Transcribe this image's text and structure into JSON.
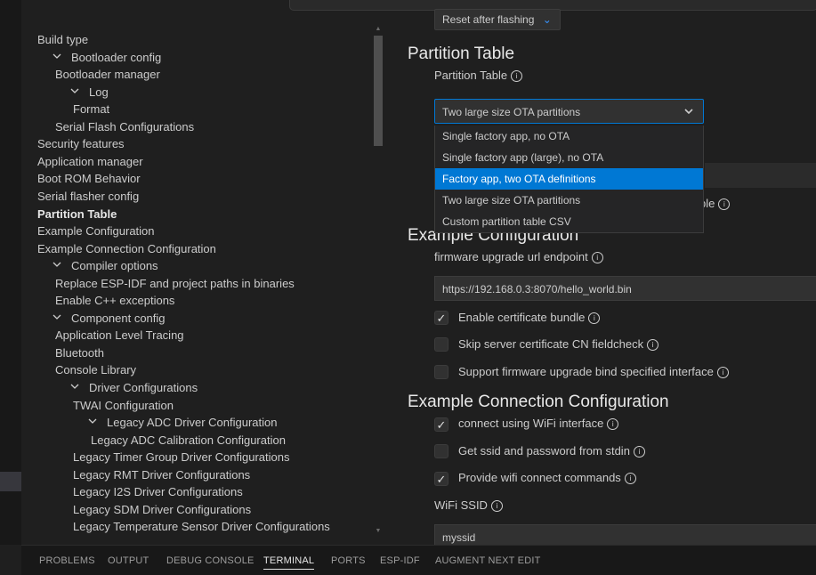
{
  "tree": {
    "items": [
      {
        "label": "Build type",
        "indent": 0,
        "chevron": false,
        "bold": false
      },
      {
        "label": "Bootloader config",
        "indent": 1,
        "chevron": true,
        "bold": false
      },
      {
        "label": "Bootloader manager",
        "indent": 1,
        "chevron": false,
        "bold": false
      },
      {
        "label": "Log",
        "indent": 2,
        "chevron": true,
        "bold": false
      },
      {
        "label": "Format",
        "indent": 2,
        "chevron": false,
        "bold": false
      },
      {
        "label": "Serial Flash Configurations",
        "indent": 1,
        "chevron": false,
        "bold": false
      },
      {
        "label": "Security features",
        "indent": 0,
        "chevron": false,
        "bold": false
      },
      {
        "label": "Application manager",
        "indent": 0,
        "chevron": false,
        "bold": false
      },
      {
        "label": "Boot ROM Behavior",
        "indent": 0,
        "chevron": false,
        "bold": false
      },
      {
        "label": "Serial flasher config",
        "indent": 0,
        "chevron": false,
        "bold": false
      },
      {
        "label": "Partition Table",
        "indent": 0,
        "chevron": false,
        "bold": true
      },
      {
        "label": "Example Configuration",
        "indent": 0,
        "chevron": false,
        "bold": false
      },
      {
        "label": "Example Connection Configuration",
        "indent": 0,
        "chevron": false,
        "bold": false
      },
      {
        "label": "Compiler options",
        "indent": 1,
        "chevron": true,
        "bold": false
      },
      {
        "label": "Replace ESP-IDF and project paths in binaries",
        "indent": 1,
        "chevron": false,
        "bold": false
      },
      {
        "label": "Enable C++ exceptions",
        "indent": 1,
        "chevron": false,
        "bold": false
      },
      {
        "label": "Component config",
        "indent": 1,
        "chevron": true,
        "bold": false
      },
      {
        "label": "Application Level Tracing",
        "indent": 1,
        "chevron": false,
        "bold": false
      },
      {
        "label": "Bluetooth",
        "indent": 1,
        "chevron": false,
        "bold": false
      },
      {
        "label": "Console Library",
        "indent": 1,
        "chevron": false,
        "bold": false
      },
      {
        "label": "Driver Configurations",
        "indent": 2,
        "chevron": true,
        "bold": false
      },
      {
        "label": "TWAI Configuration",
        "indent": 2,
        "chevron": false,
        "bold": false
      },
      {
        "label": "Legacy ADC Driver Configuration",
        "indent": 3,
        "chevron": true,
        "bold": false
      },
      {
        "label": "Legacy ADC Calibration Configuration",
        "indent": 3,
        "chevron": false,
        "bold": false
      },
      {
        "label": "Legacy Timer Group Driver Configurations",
        "indent": 2,
        "chevron": false,
        "bold": false
      },
      {
        "label": "Legacy RMT Driver Configurations",
        "indent": 2,
        "chevron": false,
        "bold": false
      },
      {
        "label": "Legacy I2S Driver Configurations",
        "indent": 2,
        "chevron": false,
        "bold": false
      },
      {
        "label": "Legacy SDM Driver Configurations",
        "indent": 2,
        "chevron": false,
        "bold": false
      },
      {
        "label": "Legacy Temperature Sensor Driver Configurations",
        "indent": 2,
        "chevron": false,
        "bold": false
      }
    ]
  },
  "main": {
    "reset_select": "Reset after flashing",
    "partition_section": "Partition Table",
    "partition_label": "Partition Table",
    "partition_select": "Two large size OTA partitions",
    "partition_options": [
      {
        "label": "Single factory app, no OTA",
        "active": false
      },
      {
        "label": "Single factory app (large), no OTA",
        "active": false
      },
      {
        "label": "Factory app, two OTA definitions",
        "active": true
      },
      {
        "label": "Two large size OTA partitions",
        "active": false
      },
      {
        "label": "Custom partition table CSV",
        "active": false
      }
    ],
    "hidden_row_tail": "ble",
    "example_section": "Example Configuration",
    "fw_url_label": "firmware upgrade url endpoint",
    "fw_url_value": "https://192.168.0.3:8070/hello_world.bin",
    "cert_bundle_label": "Enable certificate bundle",
    "cert_bundle_checked": true,
    "skip_cn_label": "Skip server certificate CN fieldcheck",
    "skip_cn_checked": false,
    "bind_iface_label": "Support firmware upgrade bind specified interface",
    "bind_iface_checked": false,
    "conn_section": "Example Connection Configuration",
    "wifi_iface_label": "connect using WiFi interface",
    "wifi_iface_checked": true,
    "ssid_stdin_label": "Get ssid and password from stdin",
    "ssid_stdin_checked": false,
    "wifi_cmds_label": "Provide wifi connect commands",
    "wifi_cmds_checked": true,
    "wifi_ssid_label": "WiFi SSID",
    "wifi_ssid_value": "myssid"
  },
  "panel": {
    "tabs": [
      {
        "label": "PROBLEMS",
        "active": false
      },
      {
        "label": "OUTPUT",
        "active": false
      },
      {
        "label": "DEBUG CONSOLE",
        "active": false
      },
      {
        "label": "TERMINAL",
        "active": true
      },
      {
        "label": "PORTS",
        "active": false
      },
      {
        "label": "ESP-IDF",
        "active": false
      },
      {
        "label": "AUGMENT NEXT EDIT",
        "active": false
      }
    ]
  },
  "icons": {
    "info": "info-icon",
    "chevron": "chevron-down-icon",
    "check": "checkmark-icon"
  },
  "colors": {
    "accent": "#0078d4",
    "background": "#1f1f1f"
  }
}
